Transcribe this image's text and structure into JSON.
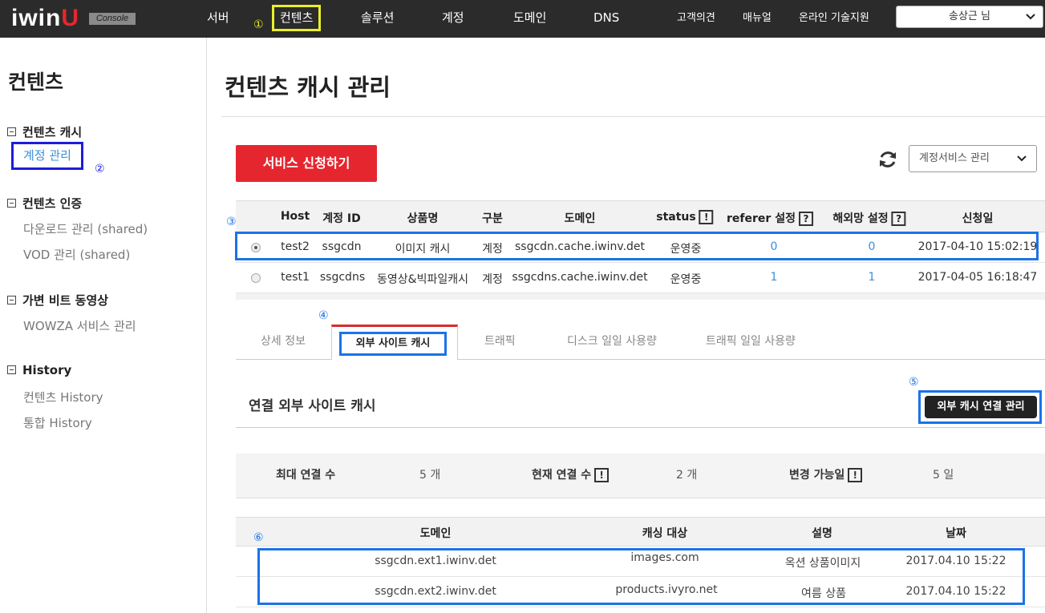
{
  "topbar": {
    "logo": "iwin",
    "logo_u": "U",
    "console_badge": "Console",
    "nav": [
      "서버",
      "컨텐츠",
      "솔루션",
      "계정",
      "도메인",
      "DNS"
    ],
    "util": [
      "고객의견",
      "매뉴얼",
      "온라인 기술지원"
    ],
    "user": "송상근 님",
    "marker": "①"
  },
  "sidebar": {
    "title": "컨텐츠",
    "groups": [
      {
        "label": "컨텐츠 캐시",
        "items": [
          "계정 관리"
        ]
      },
      {
        "label": "컨텐츠 인증",
        "items": [
          "다운로드 관리 (shared)",
          "VOD 관리 (shared)"
        ]
      },
      {
        "label": "가변 비트 동영상",
        "items": [
          "WOWZA 서비스 관리"
        ]
      },
      {
        "label": "History",
        "items": [
          "컨텐츠 History",
          "통합 History"
        ]
      }
    ],
    "marker": "②"
  },
  "main": {
    "title": "컨텐츠 캐시 관리",
    "apply_button": "서비스 신청하기",
    "service_select": "계정서비스 관리",
    "accounts": {
      "headers": [
        "Host",
        "계정 ID",
        "상품명",
        "구분",
        "도메인",
        "status",
        "referer 설정",
        "해외망 설정",
        "신청일"
      ],
      "help_mark": "?",
      "alert_mark": "!",
      "rows": [
        {
          "selected": true,
          "host": "test2",
          "id": "ssgcdn",
          "product": "이미지 캐시",
          "type": "계정",
          "domain": "ssgcdn.cache.iwinv.det",
          "status": "운영중",
          "referer": "0",
          "overseas": "0",
          "date": "2017-04-10 15:02:19"
        },
        {
          "selected": false,
          "host": "test1",
          "id": "ssgcdns",
          "product": "동영상&빅파일캐시",
          "type": "계정",
          "domain": "ssgcdns.cache.iwinv.det",
          "status": "운영중",
          "referer": "1",
          "overseas": "1",
          "date": "2017-04-05 16:18:47"
        }
      ],
      "marker": "③"
    },
    "tabs": [
      "상세 정보",
      "외부 사이트 캐시",
      "트래픽",
      "디스크 일일 사용량",
      "트래픽 일일 사용량"
    ],
    "tabs_marker": "④",
    "section_title": "연결 외부 사이트 캐시",
    "ext_button": "외부 캐시 연결 관리",
    "ext_marker": "⑤",
    "stats": {
      "max_label": "최대 연결 수",
      "max_value": "5 개",
      "cur_label": "현재 연결 수",
      "cur_value": "2 개",
      "change_label": "변경 가능일",
      "change_value": "5 일"
    },
    "external": {
      "headers": [
        "도메인",
        "캐싱 대상",
        "설명",
        "날짜"
      ],
      "rows": [
        {
          "domain": "ssgcdn.ext1.iwinv.det",
          "target": "images.com",
          "desc": "옥션 상품이미지",
          "date": "2017.04.10 15:22"
        },
        {
          "domain": "ssgcdn.ext2.iwinv.det",
          "target": "products.ivyro.net",
          "desc": "여름 상품",
          "date": "2017.04.10 15:22"
        }
      ],
      "marker": "⑥"
    }
  },
  "colors": {
    "accent_red": "#e5262f",
    "link_blue": "#3a8fd8",
    "annotation_blue": "#1a73e8",
    "annotation_yellow": "#e8ef2a"
  }
}
